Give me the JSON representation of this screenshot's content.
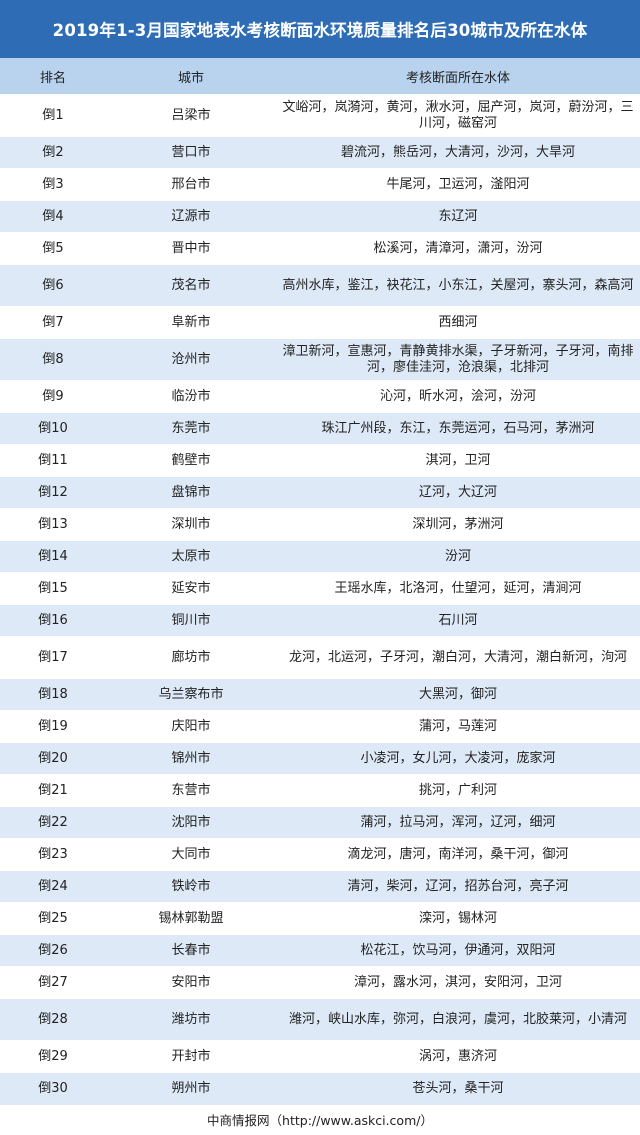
{
  "title": "2019年1-3月国家地表水考核断面水环境质量排名后30城市及所在水体",
  "columns": [
    "排名",
    "城市",
    "考核断面所在水体"
  ],
  "rows": [
    {
      "rank": "倒1",
      "city": "吕梁市",
      "water": "文峪河，岚漪河，黄河，湫水河，屈产河，岚河，蔚汾河，三川河，磁窑河"
    },
    {
      "rank": "倒2",
      "city": "营口市",
      "water": "碧流河，熊岳河，大清河，沙河，大旱河"
    },
    {
      "rank": "倒3",
      "city": "邢台市",
      "water": "牛尾河，卫运河，滏阳河"
    },
    {
      "rank": "倒4",
      "city": "辽源市",
      "water": "东辽河"
    },
    {
      "rank": "倒5",
      "city": "晋中市",
      "water": "松溪河，清漳河，潇河，汾河"
    },
    {
      "rank": "倒6",
      "city": "茂名市",
      "water": "高州水库，鉴江，袂花江，小东江，关屋河，寨头河，森高河"
    },
    {
      "rank": "倒7",
      "city": "阜新市",
      "water": "西细河"
    },
    {
      "rank": "倒8",
      "city": "沧州市",
      "water": "漳卫新河，宣惠河，青静黄排水渠，子牙新河，子牙河，南排河，廖佳洼河，沧浪渠，北排河"
    },
    {
      "rank": "倒9",
      "city": "临汾市",
      "water": "沁河，昕水河，浍河，汾河"
    },
    {
      "rank": "倒10",
      "city": "东莞市",
      "water": "珠江广州段，东江，东莞运河，石马河，茅洲河"
    },
    {
      "rank": "倒11",
      "city": "鹤壁市",
      "water": "淇河，卫河"
    },
    {
      "rank": "倒12",
      "city": "盘锦市",
      "water": "辽河，大辽河"
    },
    {
      "rank": "倒13",
      "city": "深圳市",
      "water": "深圳河，茅洲河"
    },
    {
      "rank": "倒14",
      "city": "太原市",
      "water": "汾河"
    },
    {
      "rank": "倒15",
      "city": "延安市",
      "water": "王瑶水库，北洛河，仕望河，延河，清涧河"
    },
    {
      "rank": "倒16",
      "city": "铜川市",
      "water": "石川河"
    },
    {
      "rank": "倒17",
      "city": "廊坊市",
      "water": "龙河，北运河，子牙河，潮白河，大清河，潮白新河，泃河"
    },
    {
      "rank": "倒18",
      "city": "乌兰察布市",
      "water": "大黑河，御河"
    },
    {
      "rank": "倒19",
      "city": "庆阳市",
      "water": "蒲河，马莲河"
    },
    {
      "rank": "倒20",
      "city": "锦州市",
      "water": "小凌河，女儿河，大凌河，庞家河"
    },
    {
      "rank": "倒21",
      "city": "东营市",
      "water": "挑河，广利河"
    },
    {
      "rank": "倒22",
      "city": "沈阳市",
      "water": "蒲河，拉马河，浑河，辽河，细河"
    },
    {
      "rank": "倒23",
      "city": "大同市",
      "water": "滴龙河，唐河，南洋河，桑干河，御河"
    },
    {
      "rank": "倒24",
      "city": "铁岭市",
      "water": "清河，柴河，辽河，招苏台河，亮子河"
    },
    {
      "rank": "倒25",
      "city": "锡林郭勒盟",
      "water": "滦河，锡林河"
    },
    {
      "rank": "倒26",
      "city": "长春市",
      "water": "松花江，饮马河，伊通河，双阳河"
    },
    {
      "rank": "倒27",
      "city": "安阳市",
      "water": "漳河，露水河，淇河，安阳河，卫河"
    },
    {
      "rank": "倒28",
      "city": "潍坊市",
      "water": "潍河，峡山水库，弥河，白浪河，虞河，北胶莱河，小清河"
    },
    {
      "rank": "倒29",
      "city": "开封市",
      "water": "涡河，惠济河"
    },
    {
      "rank": "倒30",
      "city": "朔州市",
      "water": "苍头河，桑干河"
    }
  ],
  "footer": "中商情报网（http://www.askci.com/）"
}
